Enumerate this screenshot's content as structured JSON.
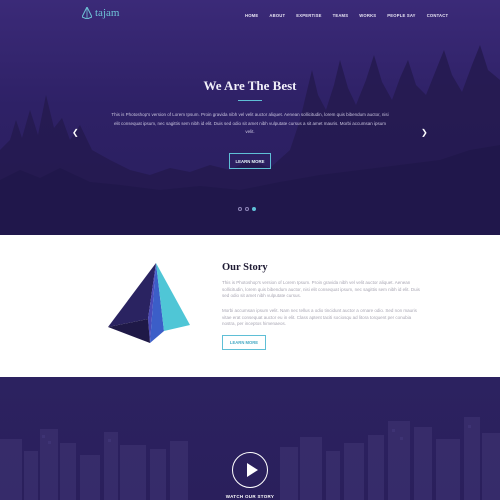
{
  "brand": {
    "name": "tajam",
    "accent": "#5fbfd6"
  },
  "nav": {
    "items": [
      {
        "label": "HOME"
      },
      {
        "label": "ABOUT"
      },
      {
        "label": "EXPERTISE"
      },
      {
        "label": "TEAMS"
      },
      {
        "label": "WORKS"
      },
      {
        "label": "PEOPLE SAY"
      },
      {
        "label": "CONTACT"
      }
    ]
  },
  "hero": {
    "title": "We Are The Best",
    "text": "This is Photoshop's version of Lorem Ipsum. Proin gravida nibh vel velit auctor aliquet. Aenean sollicitudin, lorem quis bibendum auctor, nisi elit consequat ipsum, nec sagittis sem nibh id elit. Duis sed odio sit amet nibh vulputate cursus a sit amet mauris. Morbi accumsan ipsum velit.",
    "button": "LEARN MORE",
    "prev_icon": "chevron-left-icon",
    "next_icon": "chevron-right-icon",
    "slides": 3,
    "active_slide": 3
  },
  "story": {
    "title": "Our Story",
    "paragraph1": "This is Photoshop's version of Lorem Ipsum. Proin gravida nibh vel velit auctor aliquet. Aenean sollicitudin, lorem quis bibendum auctor, nisi elit consequat ipsum, nec sagittis sem nibh id elit. Duis sed odio sit amet nibh vulputate cursus.",
    "paragraph2": "Morbi accumsan ipsum velit. Nam nec tellus a odio tincidunt auctor a ornare odio. Sed non mauris vitae erat consequat auctor eu in elit. Class aptent taciti sociosqu ad litora torquent per conubia nostra, per inceptos himenaeos.",
    "button": "LEARN MORE"
  },
  "video": {
    "label": "WATCH OUR STORY",
    "icon": "play-icon"
  }
}
